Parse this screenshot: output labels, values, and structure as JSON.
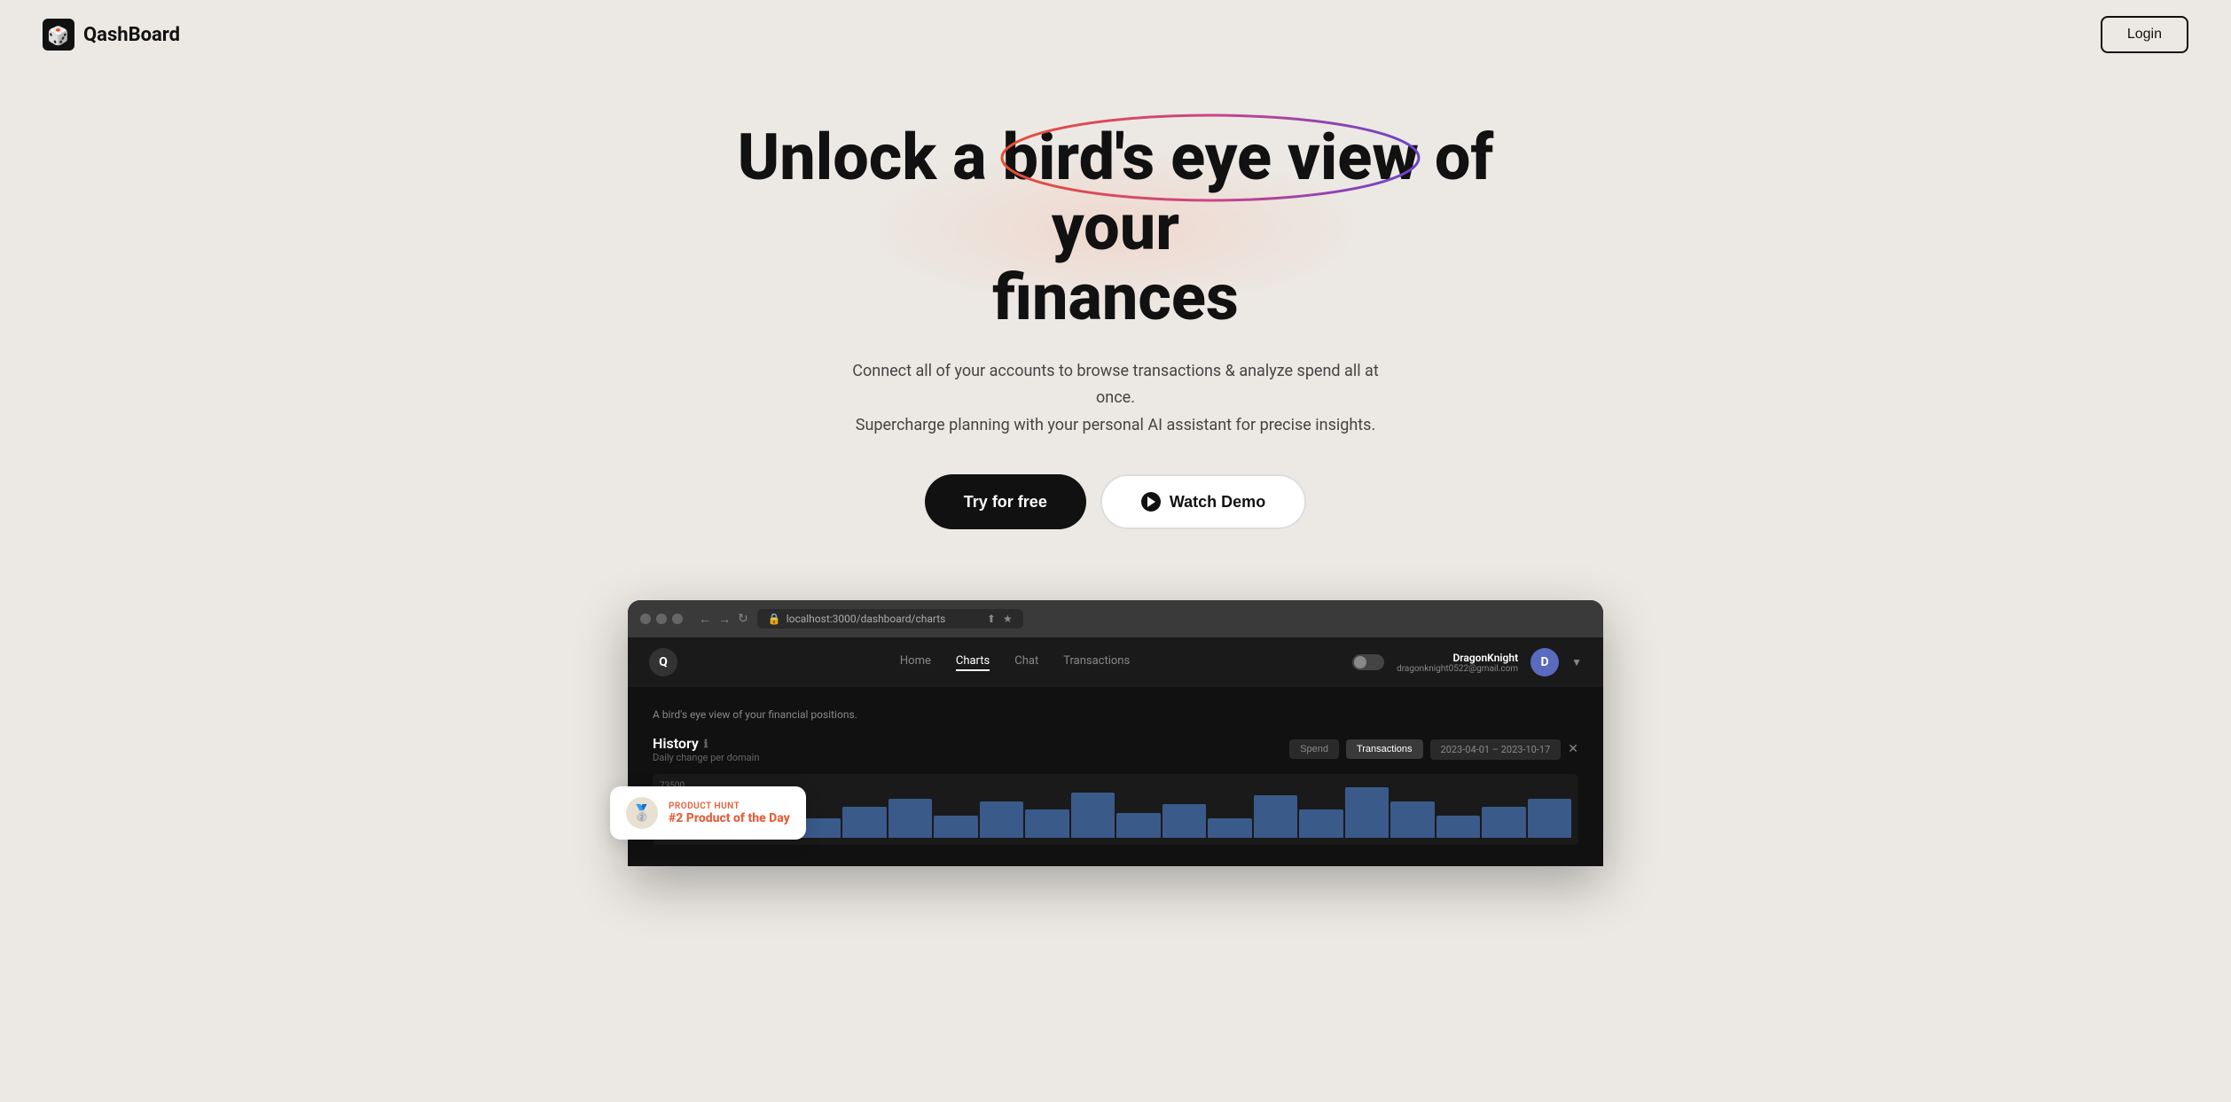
{
  "navbar": {
    "logo_text": "QashBoard",
    "login_label": "Login"
  },
  "hero": {
    "title_line1": "Unlock a bird's eye view of your",
    "title_line2": "finances",
    "highlighted_phrase": "bird's eye view",
    "subtitle_line1": "Connect all of your accounts to browse transactions & analyze spend all at once.",
    "subtitle_line2": "Supercharge planning with your personal AI assistant for precise insights.",
    "cta_primary": "Try for free",
    "cta_secondary": "Watch Demo"
  },
  "browser": {
    "address": "localhost:3000/dashboard/charts",
    "nav_links": [
      {
        "label": "Home",
        "active": false
      },
      {
        "label": "Charts",
        "active": true
      },
      {
        "label": "Chat",
        "active": false
      },
      {
        "label": "Transactions",
        "active": false
      }
    ],
    "user_name": "DragonKnight",
    "user_email": "dragonknight0522@gmail.com",
    "user_initial": "D",
    "content_label": "A bird's eye view of your financial positions.",
    "history_title": "History",
    "history_subtitle": "Daily change per domain",
    "filter_spend": "Spend",
    "filter_transactions": "Transactions",
    "date_range": "2023-04-01 – 2023-10-17",
    "chart_value": "73500"
  },
  "product_hunt": {
    "rank": "#2 Product of the Day",
    "label": "PRODUCT HUNT"
  },
  "colors": {
    "background": "#ece9e4",
    "primary_btn_bg": "#111111",
    "secondary_btn_bg": "#ffffff",
    "browser_bg": "#2a2a2a",
    "app_bg": "#111111",
    "accent_red": "#e85d3a",
    "user_avatar_bg": "#5a6abf"
  }
}
